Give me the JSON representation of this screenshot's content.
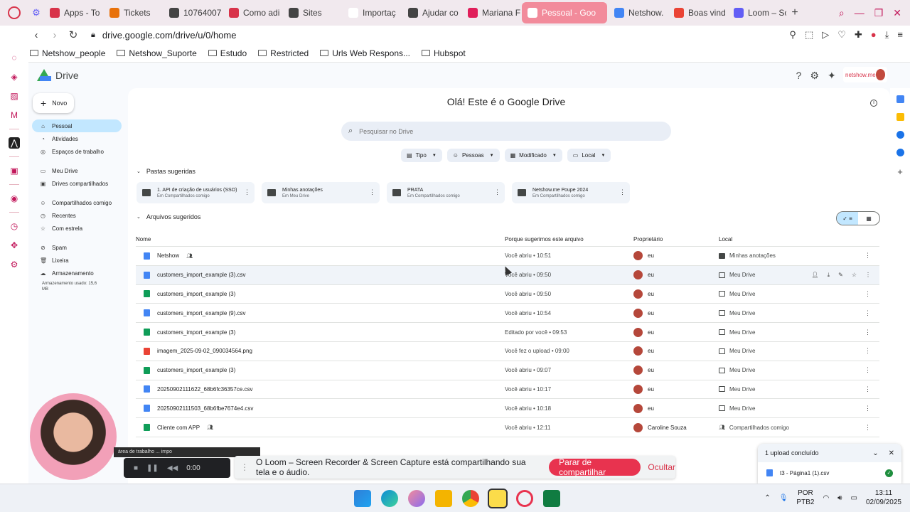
{
  "browser": {
    "tabs": [
      {
        "label": "Apps - To",
        "color": "#d8334a"
      },
      {
        "label": "Tickets",
        "color": "#e8710a"
      },
      {
        "label": "10764007",
        "color": "#444444"
      },
      {
        "label": "Como adi",
        "color": "#d8334a"
      },
      {
        "label": "Sites",
        "color": "#444444"
      },
      {
        "label": "Importaç",
        "color": "#ffffff"
      },
      {
        "label": "Ajudar co",
        "color": "#444444"
      },
      {
        "label": "Mariana F",
        "color": "#e01e5a"
      },
      {
        "label": "Pessoal - Goo",
        "color": "#ffffff",
        "active": true
      },
      {
        "label": "Netshow.",
        "color": "#4285f4"
      },
      {
        "label": "Boas vind",
        "color": "#ea4335"
      },
      {
        "label": "Loom – Sc",
        "color": "#625df5"
      }
    ],
    "url": "drive.google.com/drive/u/0/home",
    "bookmarks": [
      "Netshow_people",
      "Netshow_Suporte",
      "Estudo",
      "Restricted",
      "Urls Web Respons...",
      "Hubspot"
    ]
  },
  "drive": {
    "app_name": "Drive",
    "brand": "netshow.me",
    "new_button": "Novo",
    "nav_items": [
      {
        "label": "Pessoal",
        "icon": "home-icon",
        "active": true
      },
      {
        "label": "Atividades",
        "icon": "bell-icon"
      },
      {
        "label": "Espaços de trabalho",
        "icon": "workspace-icon"
      }
    ],
    "nav_items2": [
      {
        "label": "Meu Drive",
        "icon": "drive-icon"
      },
      {
        "label": "Drives compartilhados",
        "icon": "shared-drive-icon"
      }
    ],
    "nav_items3": [
      {
        "label": "Compartilhados comigo",
        "icon": "people-icon"
      },
      {
        "label": "Recentes",
        "icon": "clock-icon"
      },
      {
        "label": "Com estrela",
        "icon": "star-icon"
      }
    ],
    "nav_items4": [
      {
        "label": "Spam",
        "icon": "spam-icon"
      },
      {
        "label": "Lixeira",
        "icon": "trash-icon"
      },
      {
        "label": "Armazenamento",
        "icon": "cloud-icon"
      }
    ],
    "storage_used": "Armazenamento usado: 15,6 MB",
    "greeting": "Olá! Este é o Google Drive",
    "search_placeholder": "Pesquisar no Drive",
    "filters": [
      "Tipo",
      "Pessoas",
      "Modificado",
      "Local"
    ],
    "suggested_folders_title": "Pastas sugeridas",
    "folders": [
      {
        "name": "1. API de criação de usuários (SSO)",
        "sub": "Em Compartilhados comigo"
      },
      {
        "name": "Minhas anotações",
        "sub": "Em Meu Drive"
      },
      {
        "name": "PRATA",
        "sub": "Em Compartilhados comigo"
      },
      {
        "name": "Netshow.me Poupe 2024",
        "sub": "Em Compartilhados comigo"
      }
    ],
    "suggested_files_title": "Arquivos sugeridos",
    "columns": {
      "name": "Nome",
      "reason": "Porque sugerimos este arquivo",
      "owner": "Proprietário",
      "location": "Local"
    },
    "files": [
      {
        "name": "Netshow",
        "type": "doc",
        "shared": true,
        "reason": "Você abriu • 10:51",
        "owner": "eu",
        "location": "Minhas anotações",
        "loc_type": "folder"
      },
      {
        "name": "customers_import_example (3).csv",
        "type": "doc",
        "reason": "Você abriu • 09:50",
        "owner": "eu",
        "location": "Meu Drive",
        "loc_type": "drive",
        "hover": true
      },
      {
        "name": "customers_import_example (3)",
        "type": "sheet",
        "reason": "Você abriu • 09:50",
        "owner": "eu",
        "location": "Meu Drive",
        "loc_type": "drive"
      },
      {
        "name": "customers_import_example (9).csv",
        "type": "doc",
        "reason": "Você abriu • 10:54",
        "owner": "eu",
        "location": "Meu Drive",
        "loc_type": "drive"
      },
      {
        "name": "customers_import_example (3)",
        "type": "sheet",
        "reason": "Editado por você • 09:53",
        "owner": "eu",
        "location": "Meu Drive",
        "loc_type": "drive"
      },
      {
        "name": "imagem_2025-09-02_090034564.png",
        "type": "img",
        "reason": "Você fez o upload • 09:00",
        "owner": "eu",
        "location": "Meu Drive",
        "loc_type": "drive"
      },
      {
        "name": "customers_import_example (3)",
        "type": "sheet",
        "reason": "Você abriu • 09:07",
        "owner": "eu",
        "location": "Meu Drive",
        "loc_type": "drive"
      },
      {
        "name": "20250902111622_68b6fc36357ce.csv",
        "type": "doc",
        "reason": "Você abriu • 10:17",
        "owner": "eu",
        "location": "Meu Drive",
        "loc_type": "drive"
      },
      {
        "name": "20250902111503_68b6fbe7674e4.csv",
        "type": "doc",
        "reason": "Você abriu • 10:18",
        "owner": "eu",
        "location": "Meu Drive",
        "loc_type": "drive"
      },
      {
        "name": "Cliente com APP",
        "type": "sheet",
        "shared": true,
        "reason": "Você abriu • 12:11",
        "owner": "Caroline Souza",
        "location": "Compartilhados comigo",
        "loc_type": "shared"
      }
    ]
  },
  "loom": {
    "share_text": "O Loom – Screen Recorder & Screen Capture está compartilhando sua tela e o áudio.",
    "stop_label": "Parar de compartilhar",
    "hide_label": "Ocultar",
    "timer": "0:00",
    "hint": "área de trabalho ... impo"
  },
  "upload": {
    "title": "1 upload concluído",
    "file": "t3 - Página1 (1).csv"
  },
  "taskbar": {
    "lang1": "POR",
    "lang2": "PTB2",
    "time": "13:11",
    "date": "02/09/2025"
  }
}
